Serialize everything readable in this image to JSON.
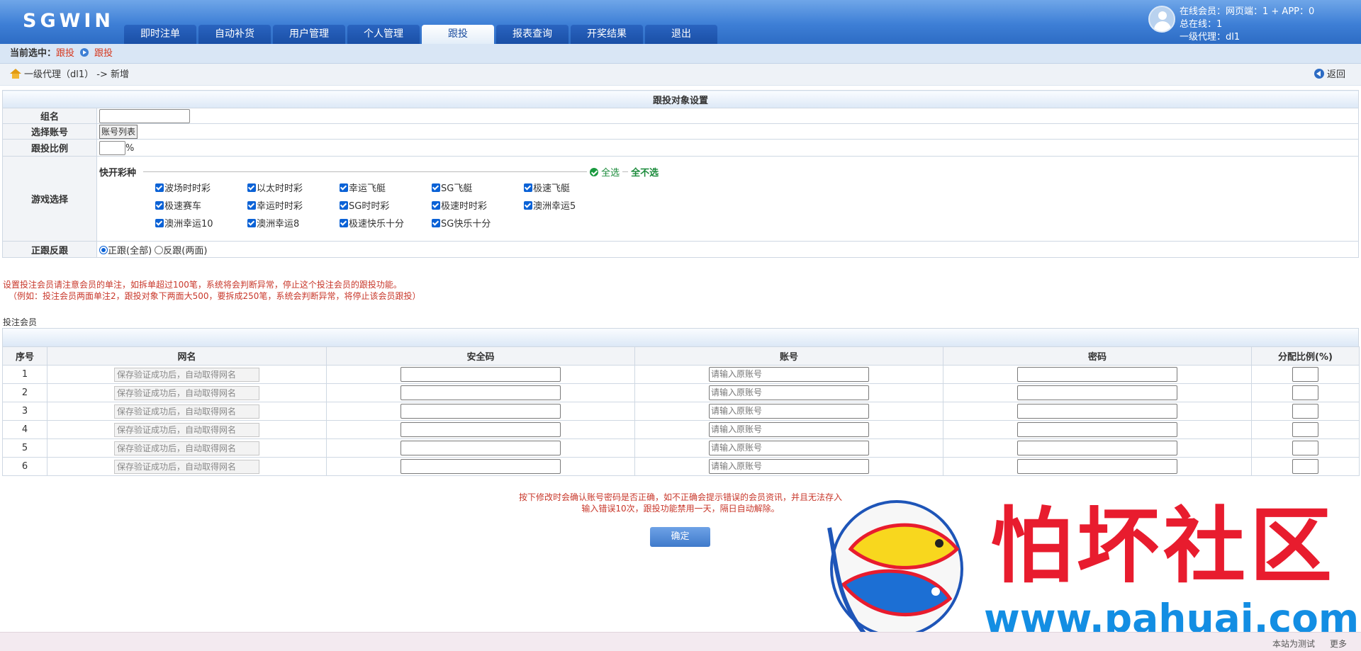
{
  "header": {
    "logo": "SGWIN",
    "nav": [
      "即时注单",
      "自动补货",
      "用户管理",
      "个人管理",
      "跟投",
      "报表查询",
      "开奖结果",
      "退出"
    ],
    "active_nav": "跟投",
    "user": {
      "online": "在线会员：网页端：1 + APP：0",
      "total": "总在线：1",
      "agent": "一级代理：dl1"
    }
  },
  "selection_bar": {
    "label": "当前选中：",
    "item1": "跟投",
    "item2": "跟投"
  },
  "breadcrumb": {
    "path": "一级代理（dl1）",
    "action": "-> 新增",
    "back": "返回"
  },
  "form": {
    "title": "跟投对象设置",
    "group_name_label": "组名",
    "group_name_value": "",
    "account_label": "选择账号",
    "account_button": "账号列表",
    "ratio_label": "跟投比例",
    "ratio_unit": "%",
    "game_label": "游戏选择",
    "game_section": "快开彩种",
    "select_all": "全选",
    "select_none": "全不选",
    "games": [
      "波场时时彩",
      "以太时时彩",
      "幸运飞艇",
      "SG飞艇",
      "极速飞艇",
      "极速赛车",
      "幸运时时彩",
      "SG时时彩",
      "极速时时彩",
      "澳洲幸运5",
      "澳洲幸运10",
      "澳洲幸运8",
      "极速快乐十分",
      "SG快乐十分"
    ],
    "direction_label": "正跟反跟",
    "direction_options": [
      "正跟(全部)",
      "反跟(两面)"
    ],
    "direction_selected": "正跟(全部)"
  },
  "notes": {
    "line1": "设置投注会员请注意会员的单注，如拆单超过100笔，系统将会判断异常，停止这个投注会员的跟投功能。",
    "line2": "（例如：投注会员两面单注2，跟投对象下两面大500，要拆成250笔，系统会判断异常，将停止该会员跟投）",
    "member_label": "投注会员"
  },
  "members": {
    "columns": [
      "序号",
      "网名",
      "安全码",
      "账号",
      "密码",
      "分配比例(%)"
    ],
    "name_placeholder": "保存验证成功后，自动取得网名",
    "account_placeholder": "请输入原账号",
    "rows": [
      "1",
      "2",
      "3",
      "4",
      "5",
      "6"
    ]
  },
  "footer": {
    "warn1": "按下修改时会确认账号密码是否正确，如不正确会提示错误的会员资讯，并且无法存入",
    "warn2": "输入错误10次，跟投功能禁用一天，隔日自动解除。",
    "confirm": "确定",
    "site_test": "本站为测试",
    "more": "更多"
  },
  "watermark": {
    "title": "怕坏社区",
    "url": "www.pahuai.com"
  }
}
